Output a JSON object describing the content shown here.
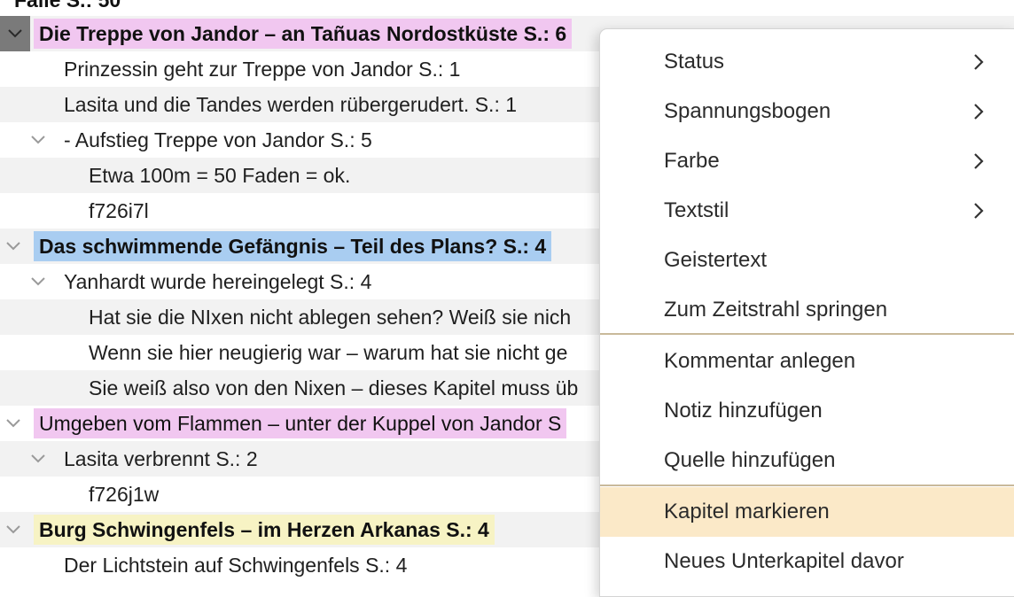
{
  "outline": {
    "rows": [
      {
        "text": "Falle  S.: 50"
      },
      {
        "text": "Die Treppe von Jandor – an Tañuas Nordostküste  S.: 6"
      },
      {
        "text": "Prinzessin geht zur Treppe von Jandor  S.: 1"
      },
      {
        "text": "Lasita und die Tandes werden rübergerudert.  S.: 1"
      },
      {
        "text": "- Aufstieg Treppe von Jandor  S.: 5"
      },
      {
        "text": "Etwa 100m = 50 Faden = ok."
      },
      {
        "text": "f726i7l"
      },
      {
        "text": "Das schwimmende Gefängnis – Teil des Plans?  S.: 4"
      },
      {
        "text": "Yanhardt wurde hereingelegt  S.: 4"
      },
      {
        "text": "Hat sie die NIxen nicht ablegen sehen? Weiß sie nich"
      },
      {
        "text": "Wenn sie hier neugierig war – warum hat sie nicht ge"
      },
      {
        "text": "Sie weiß also von den Nixen – dieses Kapitel muss üb"
      },
      {
        "text": "Umgeben vom Flammen – unter der Kuppel von Jandor  S"
      },
      {
        "text": "Lasita verbrennt  S.: 2"
      },
      {
        "text": "f726j1w"
      },
      {
        "text": "Burg Schwingenfels  – im Herzen Arkanas  S.: 4"
      },
      {
        "text": "Der Lichtstein auf Schwingenfels  S.: 4"
      }
    ]
  },
  "context_menu": {
    "items": [
      {
        "label": "Status",
        "submenu": true
      },
      {
        "label": "Spannungsbogen",
        "submenu": true
      },
      {
        "label": "Farbe",
        "submenu": true
      },
      {
        "label": "Textstil",
        "submenu": true
      },
      {
        "label": "Geistertext",
        "submenu": false
      },
      {
        "label": "Zum Zeitstrahl springen",
        "submenu": false
      },
      {
        "label": "Kommentar anlegen",
        "submenu": false
      },
      {
        "label": "Notiz hinzufügen",
        "submenu": false
      },
      {
        "label": "Quelle hinzufügen",
        "submenu": false
      },
      {
        "label": "Kapitel markieren",
        "submenu": false,
        "highlighted": true
      },
      {
        "label": "Neues Unterkapitel davor",
        "submenu": false
      }
    ]
  },
  "colors": {
    "pink_label": "#f1c7f0",
    "blue_label": "#a9cdf1",
    "yellow_label": "#f7f3c4",
    "menu_highlight": "#fbe9c8",
    "selected_chevron_bg": "#7a7a7a"
  }
}
